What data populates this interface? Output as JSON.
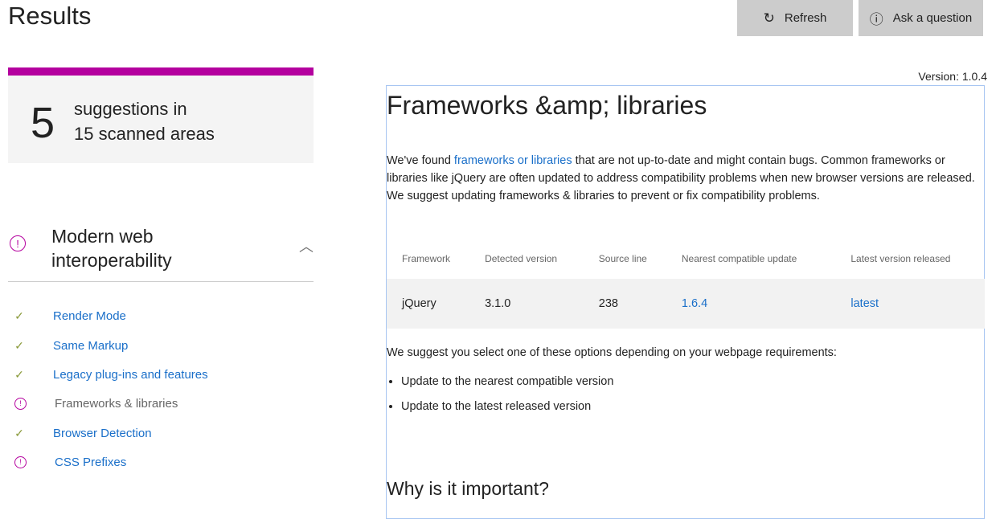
{
  "header": {
    "title": "Results",
    "refresh_label": "Refresh",
    "ask_label": "Ask a question",
    "version": "Version: 1.0.4"
  },
  "summary": {
    "count": "5",
    "text_line1": "suggestions in",
    "text_line2": "15 scanned areas",
    "accent": "#b4009e"
  },
  "section": {
    "title_line1": "Modern web",
    "title_line2": "interoperability",
    "items": [
      {
        "label": "Render Mode",
        "status": "check"
      },
      {
        "label": "Same Markup",
        "status": "check"
      },
      {
        "label": "Legacy plug-ins and features",
        "status": "check"
      },
      {
        "label": "Frameworks & libraries",
        "status": "warning"
      },
      {
        "label": "Browser Detection",
        "status": "check"
      },
      {
        "label": "CSS Prefixes",
        "status": "warning"
      }
    ]
  },
  "content": {
    "heading": "Frameworks &amp; libraries",
    "intro_before": "We've found ",
    "intro_link": "frameworks or libraries",
    "intro_after": " that are not up-to-date and might contain bugs. Common frameworks or libraries like jQuery are often updated to address compatibility problems when new browser versions are released. We suggest updating frameworks & libraries to prevent or fix compatibility problems.",
    "table": {
      "headers": [
        "Framework",
        "Detected version",
        "Source line",
        "Nearest compatible update",
        "Latest version released"
      ],
      "row": [
        "jQuery",
        "3.1.0",
        "238",
        "1.6.4",
        "latest"
      ]
    },
    "options_text": "We suggest you select one of these options depending on your webpage requirements:",
    "options": [
      "Update to the nearest compatible version",
      "Update to the latest released version"
    ],
    "subheading": "Why is it important?"
  }
}
